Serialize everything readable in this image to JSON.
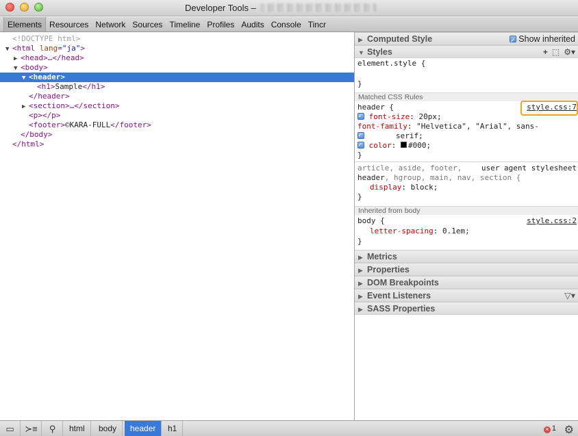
{
  "window": {
    "title": "Developer Tools –"
  },
  "tabs": [
    "Elements",
    "Resources",
    "Network",
    "Sources",
    "Timeline",
    "Profiles",
    "Audits",
    "Console",
    "Tincr"
  ],
  "dom": {
    "doctype": "<!DOCTYPE html>",
    "html_open": "<html",
    "lang_attr": "lang",
    "lang_val": "\"ja\"",
    "head": "<head>…</head>",
    "body_open": "<body>",
    "header_open": "<header>",
    "h1_open": "<h1>",
    "h1_text": "Sample",
    "h1_close": "</h1>",
    "header_close": "</header>",
    "section": "<section>…</section>",
    "p": "<p></p>",
    "footer_open": "<footer>",
    "footer_text": "©KARA-FULL",
    "footer_close": "</footer>",
    "body_close": "</body>",
    "html_close": "</html>"
  },
  "sidebar": {
    "computed_style": "Computed Style",
    "show_inherited": "Show inherited",
    "styles": "Styles",
    "element_style": "element.style {",
    "close_brace": "}",
    "matched_rules": "Matched CSS Rules",
    "rule1": {
      "selector": "header {",
      "source": "style.css:7",
      "font_size_prop": "font-size",
      "font_size_val": "20px;",
      "font_family_prop": "font-family",
      "font_family_val": "\"Helvetica\", \"Arial\", sans-",
      "font_family_val2": "serif;",
      "color_prop": "color",
      "color_val": "#000;"
    },
    "rule2": {
      "selector_line1": "article, aside, footer,",
      "source": "user agent stylesheet",
      "selector_line2_a": "header",
      "selector_line2_b": ", hgroup, main, nav, section {",
      "display_prop": "display",
      "display_val": "block;"
    },
    "inherited_from": "Inherited from",
    "inherited_el": "body",
    "rule3": {
      "selector": "body {",
      "source": "style.css:2",
      "prop": "letter-spacing",
      "val": "0.1em;"
    },
    "metrics": "Metrics",
    "properties": "Properties",
    "dom_breakpoints": "DOM Breakpoints",
    "event_listeners": "Event Listeners",
    "sass_properties": "SASS Properties"
  },
  "breadcrumbs": [
    "html",
    "body",
    "header",
    "h1"
  ],
  "status": {
    "error_count": "1"
  }
}
